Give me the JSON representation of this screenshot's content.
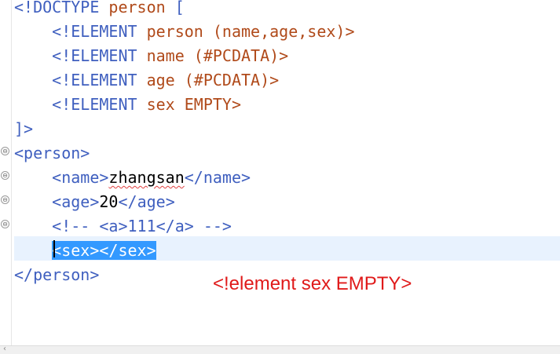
{
  "editor": {
    "lines": [
      {
        "indent": "",
        "parts": [
          {
            "t": "<!DOCTYPE ",
            "c": "tag"
          },
          {
            "t": "person",
            "c": "elname"
          },
          {
            "t": " [",
            "c": "tag"
          }
        ]
      },
      {
        "indent": "    ",
        "parts": [
          {
            "t": "<!ELEMENT ",
            "c": "tag"
          },
          {
            "t": "person",
            "c": "elname"
          },
          {
            "t": " (name,age,sex)>",
            "c": "elname"
          }
        ]
      },
      {
        "indent": "    ",
        "parts": [
          {
            "t": "<!ELEMENT ",
            "c": "tag"
          },
          {
            "t": "name",
            "c": "elname"
          },
          {
            "t": " (#PCDATA)>",
            "c": "elname"
          }
        ]
      },
      {
        "indent": "    ",
        "parts": [
          {
            "t": "<!ELEMENT ",
            "c": "tag"
          },
          {
            "t": "age",
            "c": "elname"
          },
          {
            "t": " (#PCDATA)>",
            "c": "elname"
          }
        ]
      },
      {
        "indent": "    ",
        "parts": [
          {
            "t": "<!ELEMENT ",
            "c": "tag"
          },
          {
            "t": "sex",
            "c": "elname"
          },
          {
            "t": " EMPTY>",
            "c": "elname"
          }
        ]
      },
      {
        "indent": "",
        "parts": [
          {
            "t": "]>",
            "c": "tag"
          }
        ]
      },
      {
        "indent": "",
        "parts": [
          {
            "t": "<person>",
            "c": "tag"
          }
        ]
      },
      {
        "indent": "    ",
        "parts": [
          {
            "t": "<name>",
            "c": "tag"
          },
          {
            "t": "zhangsan",
            "c": "txt",
            "squiggle": true
          },
          {
            "t": "</name>",
            "c": "tag"
          }
        ]
      },
      {
        "indent": "    ",
        "parts": [
          {
            "t": "<age>",
            "c": "tag"
          },
          {
            "t": "20",
            "c": "txt"
          },
          {
            "t": "</age>",
            "c": "tag"
          }
        ]
      },
      {
        "indent": "    ",
        "parts": [
          {
            "t": "<!-- <a>111</a> -->",
            "c": "comment"
          }
        ]
      },
      {
        "indent": "    ",
        "parts": [
          {
            "t": "<sex></sex>",
            "c": "sel"
          }
        ]
      },
      {
        "indent": "",
        "parts": [
          {
            "t": "</person>",
            "c": "tag"
          }
        ]
      }
    ],
    "fold_markers": [
      "⊖",
      "⊖",
      "⊖",
      "⊖"
    ]
  },
  "annotation": {
    "text": "<!element sex EMPTY>",
    "color": "#e01a1a"
  },
  "colors": {
    "tag": "#3f5fbf",
    "element_name": "#b04a1a",
    "selection": "#3399ff",
    "current_line": "#e8f2fe"
  }
}
